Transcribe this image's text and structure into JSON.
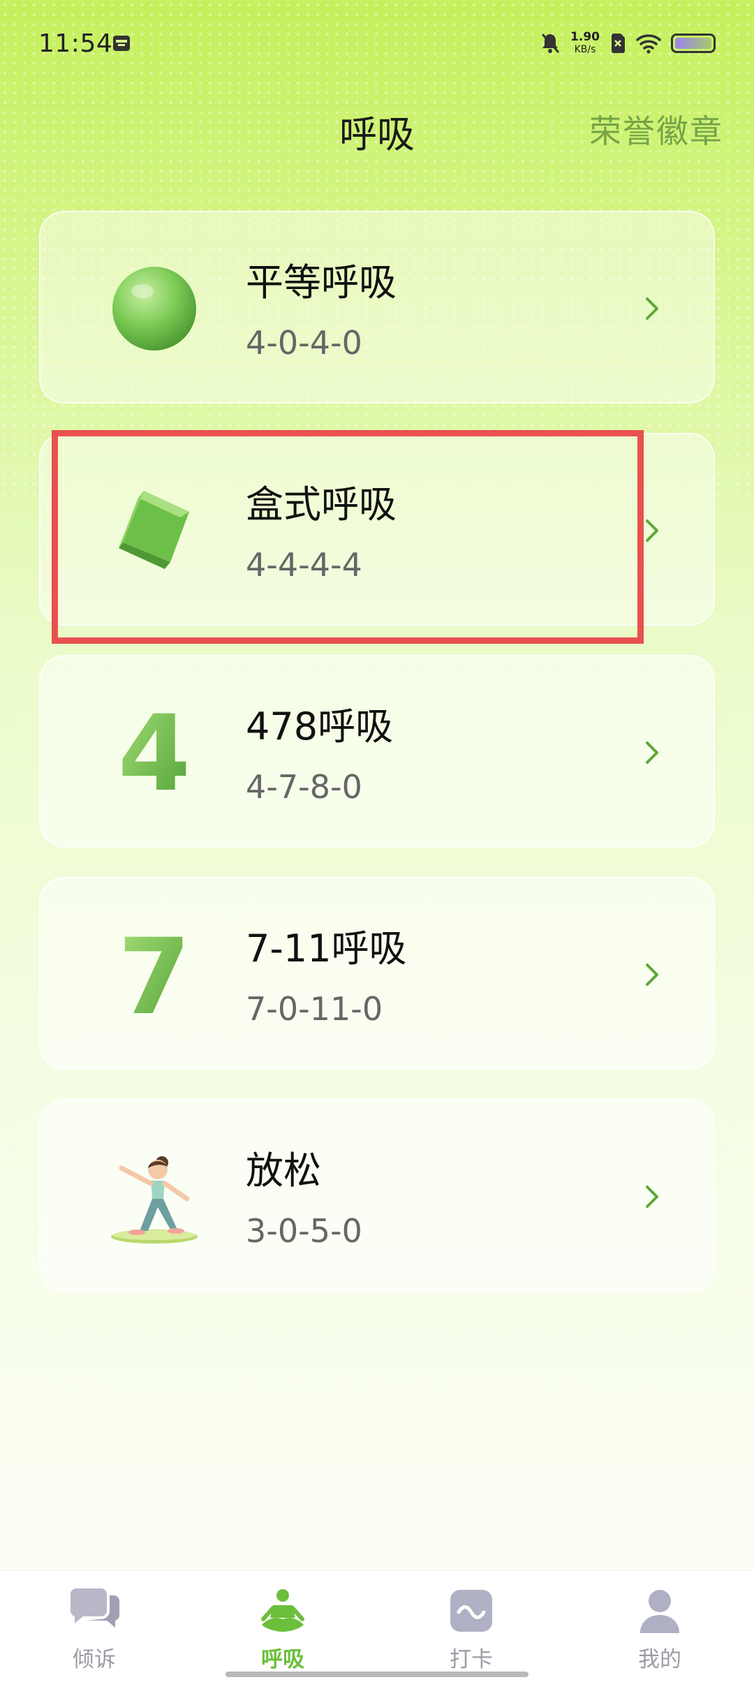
{
  "status": {
    "time": "11:54",
    "net_speed_value": "1.90",
    "net_speed_unit": "KB/s"
  },
  "header": {
    "title": "呼吸",
    "badge_link": "荣誉徽章"
  },
  "breathing_list": [
    {
      "title": "平等呼吸",
      "pattern": "4-0-4-0",
      "icon": "green-sphere-icon"
    },
    {
      "title": "盒式呼吸",
      "pattern": "4-4-4-4",
      "icon": "green-cube-icon"
    },
    {
      "title": "478呼吸",
      "pattern": "4-7-8-0",
      "icon": "number-four-icon"
    },
    {
      "title": "7-11呼吸",
      "pattern": "7-0-11-0",
      "icon": "number-seven-icon"
    },
    {
      "title": "放松",
      "pattern": "3-0-5-0",
      "icon": "yoga-girl-icon"
    }
  ],
  "bottom_nav": {
    "items": [
      {
        "label": "倾诉",
        "icon": "chat-bubbles-icon",
        "active": false
      },
      {
        "label": "呼吸",
        "icon": "meditation-icon",
        "active": true
      },
      {
        "label": "打卡",
        "icon": "checkin-wave-icon",
        "active": false
      },
      {
        "label": "我的",
        "icon": "profile-icon",
        "active": false
      }
    ]
  },
  "colors": {
    "accent": "#6cbf3a",
    "link": "#74a446",
    "highlight": "#e8514f",
    "nav_inactive": "#9c9ca6"
  }
}
